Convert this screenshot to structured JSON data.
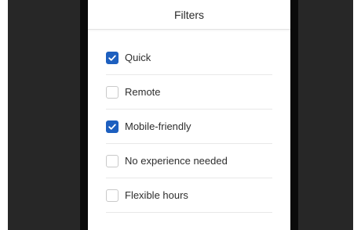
{
  "panel": {
    "title": "Filters"
  },
  "filters": [
    {
      "label": "Quick",
      "checked": true
    },
    {
      "label": "Remote",
      "checked": false
    },
    {
      "label": "Mobile-friendly",
      "checked": true
    },
    {
      "label": "No experience needed",
      "checked": false
    },
    {
      "label": "Flexible hours",
      "checked": false
    }
  ],
  "colors": {
    "accent": "#1d5fbf",
    "backdrop": "#272727"
  }
}
